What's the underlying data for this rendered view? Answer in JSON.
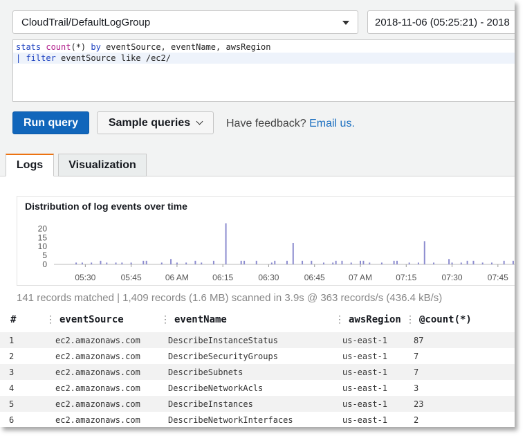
{
  "log_group": {
    "value": "CloudTrail/DefaultLogGroup"
  },
  "time_range": {
    "value": "2018-11-06 (05:25:21) - 2018"
  },
  "query": {
    "line1": [
      {
        "t": "stats ",
        "c": "kw"
      },
      {
        "t": "count",
        "c": "fn"
      },
      {
        "t": "(*) ",
        "c": "pl"
      },
      {
        "t": "by ",
        "c": "kw"
      },
      {
        "t": "eventSource, eventName, awsRegion",
        "c": "pl"
      }
    ],
    "line2": [
      {
        "t": "| ",
        "c": "kw"
      },
      {
        "t": "filter ",
        "c": "kw"
      },
      {
        "t": "eventSource like /ec2/",
        "c": "pl"
      }
    ]
  },
  "toolbar": {
    "run_label": "Run query",
    "sample_label": "Sample queries",
    "feedback_text": "Have feedback?",
    "feedback_link": "Email us."
  },
  "tabs": [
    {
      "label": "Logs",
      "active": true
    },
    {
      "label": "Visualization",
      "active": false
    }
  ],
  "histogram": {
    "title": "Distribution of log events over time"
  },
  "chart_data": {
    "type": "bar",
    "title": "Distribution of log events over time",
    "ylim": [
      0,
      24
    ],
    "yticks": [
      0,
      5,
      10,
      15,
      20
    ],
    "xticks": [
      "05:30",
      "05:45",
      "06 AM",
      "06:15",
      "06:30",
      "06:45",
      "07 AM",
      "07:15",
      "07:30",
      "07:45"
    ],
    "bars": [
      {
        "t": "05:27",
        "v": 1
      },
      {
        "t": "05:29",
        "v": 1
      },
      {
        "t": "05:32",
        "v": 1
      },
      {
        "t": "05:35",
        "v": 2
      },
      {
        "t": "05:37",
        "v": 1
      },
      {
        "t": "05:40",
        "v": 1
      },
      {
        "t": "05:42",
        "v": 1
      },
      {
        "t": "05:45",
        "v": 1
      },
      {
        "t": "05:49",
        "v": 2
      },
      {
        "t": "05:50",
        "v": 2
      },
      {
        "t": "05:55",
        "v": 1
      },
      {
        "t": "05:58",
        "v": 3
      },
      {
        "t": "06:00",
        "v": 1
      },
      {
        "t": "06:03",
        "v": 1
      },
      {
        "t": "06:06",
        "v": 2
      },
      {
        "t": "06:08",
        "v": 1
      },
      {
        "t": "06:12",
        "v": 2
      },
      {
        "t": "06:16",
        "v": 23
      },
      {
        "t": "06:21",
        "v": 2
      },
      {
        "t": "06:22",
        "v": 2
      },
      {
        "t": "06:26",
        "v": 2
      },
      {
        "t": "06:31",
        "v": 1
      },
      {
        "t": "06:32",
        "v": 2
      },
      {
        "t": "06:36",
        "v": 2
      },
      {
        "t": "06:38",
        "v": 12
      },
      {
        "t": "06:41",
        "v": 2
      },
      {
        "t": "06:44",
        "v": 2
      },
      {
        "t": "06:48",
        "v": 1
      },
      {
        "t": "06:51",
        "v": 1
      },
      {
        "t": "06:52",
        "v": 2
      },
      {
        "t": "06:54",
        "v": 2
      },
      {
        "t": "06:57",
        "v": 1
      },
      {
        "t": "07:00",
        "v": 2
      },
      {
        "t": "07:01",
        "v": 2
      },
      {
        "t": "07:03",
        "v": 1
      },
      {
        "t": "07:07",
        "v": 1
      },
      {
        "t": "07:11",
        "v": 2
      },
      {
        "t": "07:12",
        "v": 2
      },
      {
        "t": "07:16",
        "v": 1
      },
      {
        "t": "07:19",
        "v": 1
      },
      {
        "t": "07:21",
        "v": 13
      },
      {
        "t": "07:24",
        "v": 1
      },
      {
        "t": "07:29",
        "v": 3
      },
      {
        "t": "07:30",
        "v": 1
      },
      {
        "t": "07:33",
        "v": 1
      },
      {
        "t": "07:35",
        "v": 2
      },
      {
        "t": "07:37",
        "v": 2
      },
      {
        "t": "07:40",
        "v": 1
      },
      {
        "t": "07:43",
        "v": 1
      },
      {
        "t": "07:47",
        "v": 2
      },
      {
        "t": "07:50",
        "v": 2
      },
      {
        "t": "07:51",
        "v": 1
      }
    ]
  },
  "summary": "141 records matched | 1,409 records (1.6 MB) scanned in 3.9s @ 363 records/s (436.4 kB/s)",
  "table": {
    "columns": [
      "#",
      "eventSource",
      "eventName",
      "awsRegion",
      "@count(*)"
    ],
    "rows": [
      [
        "1",
        "ec2.amazonaws.com",
        "DescribeInstanceStatus",
        "us-east-1",
        "87"
      ],
      [
        "2",
        "ec2.amazonaws.com",
        "DescribeSecurityGroups",
        "us-east-1",
        "7"
      ],
      [
        "3",
        "ec2.amazonaws.com",
        "DescribeSubnets",
        "us-east-1",
        "7"
      ],
      [
        "4",
        "ec2.amazonaws.com",
        "DescribeNetworkAcls",
        "us-east-1",
        "3"
      ],
      [
        "5",
        "ec2.amazonaws.com",
        "DescribeInstances",
        "us-east-1",
        "23"
      ],
      [
        "6",
        "ec2.amazonaws.com",
        "DescribeNetworkInterfaces",
        "us-east-1",
        "2"
      ]
    ]
  },
  "colors": {
    "accent": "#1166bb",
    "bar": "#8c8ccf",
    "tab_active": "#ec7211",
    "link": "#1b6fc0"
  }
}
